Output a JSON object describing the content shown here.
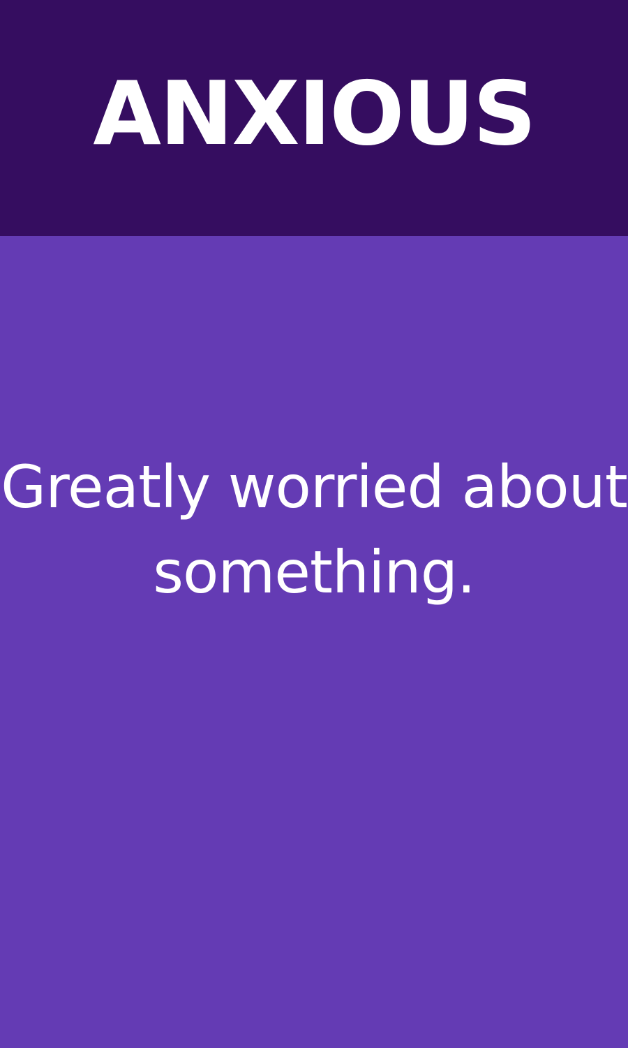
{
  "card": {
    "word": "ANXIOUS",
    "definition_lines": [
      "Greatly worried about",
      "something."
    ]
  },
  "colors": {
    "header_background": "#350d60",
    "body_background": "#643bb4",
    "text": "#ffffff"
  }
}
